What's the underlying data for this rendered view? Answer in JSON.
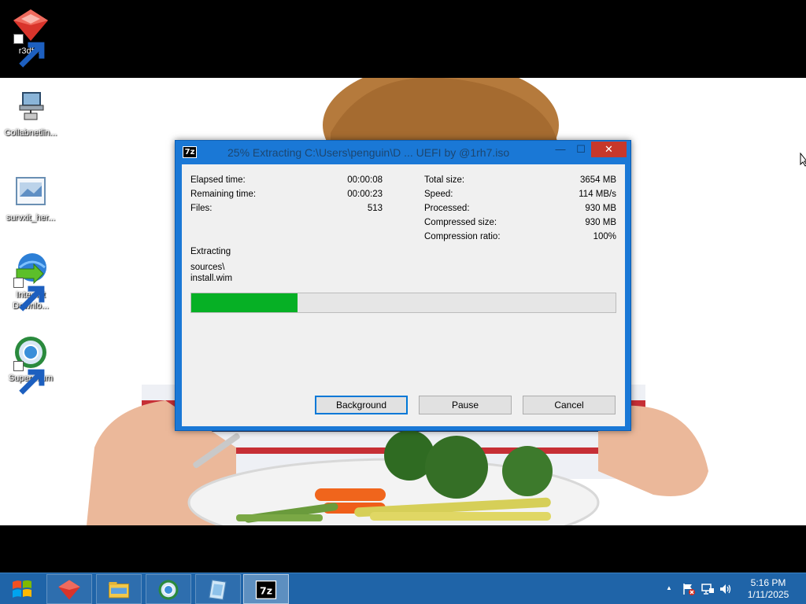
{
  "desktop": {
    "icons": [
      {
        "label": "r3dfox"
      },
      {
        "label": "Collabnetlin..."
      },
      {
        "label": "survxit_her..."
      },
      {
        "label": "Internet Downlo..."
      },
      {
        "label": "Supermium"
      }
    ]
  },
  "window": {
    "app_icon_label": "7z",
    "title": "25% Extracting C:\\Users\\penguin\\D ... UEFI by @1rh7.iso",
    "controls": {
      "minimize": "—",
      "maximize": "☐",
      "close": "✕"
    },
    "stats_left": [
      {
        "label": "Elapsed time:",
        "value": "00:00:08"
      },
      {
        "label": "Remaining time:",
        "value": "00:00:23"
      },
      {
        "label": "Files:",
        "value": "513"
      }
    ],
    "stats_right": [
      {
        "label": "Total size:",
        "value": "3654 MB"
      },
      {
        "label": "Speed:",
        "value": "114 MB/s"
      },
      {
        "label": "Processed:",
        "value": "930 MB"
      },
      {
        "label": "Compressed size:",
        "value": "930 MB"
      },
      {
        "label": "Compression ratio:",
        "value": "100%"
      }
    ],
    "status_label": "Extracting",
    "current_path": "sources\\",
    "current_file": "install.wim",
    "progress_percent": 25,
    "buttons": {
      "background": "Background",
      "pause": "Pause",
      "cancel": "Cancel"
    }
  },
  "taskbar": {
    "apps": [
      "r3dfox",
      "File Explorer",
      "Supermium",
      "survxit",
      "7-Zip"
    ],
    "tray_up_arrow": "▲",
    "clock_time": "5:16 PM",
    "clock_date": "1/11/2025"
  },
  "colors": {
    "window_frame": "#1a78d6",
    "progress_fill": "#06b025",
    "close_button": "#c7382b",
    "taskbar": "#1f64a8"
  }
}
